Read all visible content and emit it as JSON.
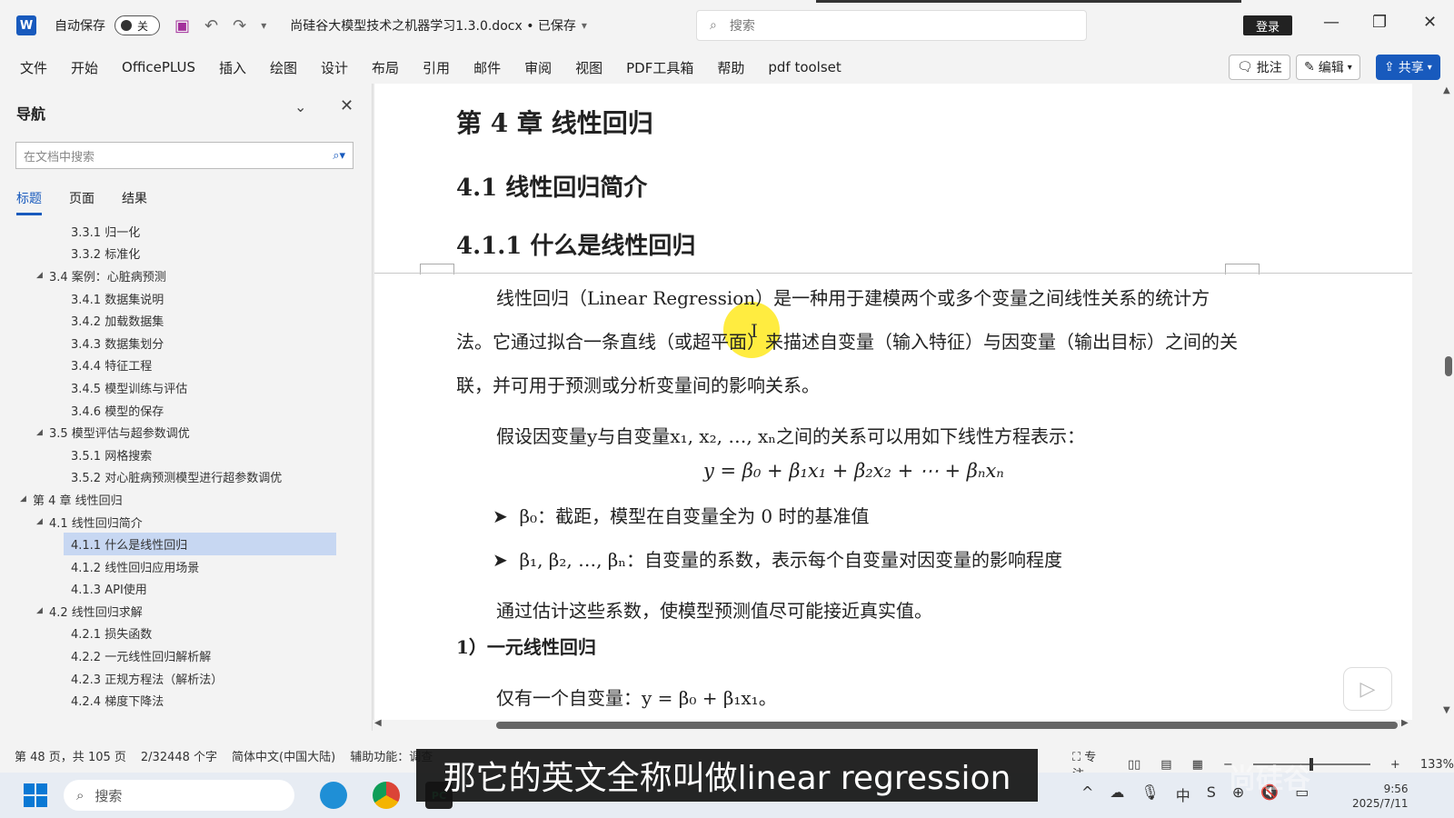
{
  "titlebar": {
    "app_icon": "W",
    "autosave_label": "自动保存",
    "autosave_state": "关",
    "document_title": "尚硅谷大模型技术之机器学习1.3.0.docx • 已保存",
    "search_placeholder": "搜索",
    "login_label": "登录"
  },
  "ribbon": {
    "tabs": [
      "文件",
      "开始",
      "OfficePLUS",
      "插入",
      "绘图",
      "设计",
      "布局",
      "引用",
      "邮件",
      "审阅",
      "视图",
      "PDF工具箱",
      "帮助",
      "pdf toolset"
    ],
    "comment_label": "批注",
    "edit_label": "编辑",
    "share_label": "共享"
  },
  "nav": {
    "title": "导航",
    "search_placeholder": "在文档中搜索",
    "tabs": [
      "标题",
      "页面",
      "结果"
    ],
    "items": [
      {
        "label": "3.3.1 归一化",
        "level": 3,
        "arrow": ""
      },
      {
        "label": "3.3.2 标准化",
        "level": 3,
        "arrow": ""
      },
      {
        "label": "3.4 案例：心脏病预测",
        "level": 2,
        "arrow": "◢"
      },
      {
        "label": "3.4.1 数据集说明",
        "level": 3,
        "arrow": ""
      },
      {
        "label": "3.4.2 加载数据集",
        "level": 3,
        "arrow": ""
      },
      {
        "label": "3.4.3 数据集划分",
        "level": 3,
        "arrow": ""
      },
      {
        "label": "3.4.4 特征工程",
        "level": 3,
        "arrow": ""
      },
      {
        "label": "3.4.5 模型训练与评估",
        "level": 3,
        "arrow": ""
      },
      {
        "label": "3.4.6 模型的保存",
        "level": 3,
        "arrow": ""
      },
      {
        "label": "3.5 模型评估与超参数调优",
        "level": 2,
        "arrow": "◢"
      },
      {
        "label": "3.5.1 网格搜索",
        "level": 3,
        "arrow": ""
      },
      {
        "label": "3.5.2 对心脏病预测模型进行超参数调优",
        "level": 3,
        "arrow": ""
      },
      {
        "label": "第 4 章 线性回归",
        "level": 1,
        "arrow": "◢"
      },
      {
        "label": "4.1 线性回归简介",
        "level": 2,
        "arrow": "◢"
      },
      {
        "label": "4.1.1 什么是线性回归",
        "level": 3,
        "arrow": "",
        "selected": true
      },
      {
        "label": "4.1.2 线性回归应用场景",
        "level": 3,
        "arrow": ""
      },
      {
        "label": "4.1.3 API使用",
        "level": 3,
        "arrow": ""
      },
      {
        "label": "4.2 线性回归求解",
        "level": 2,
        "arrow": "◢"
      },
      {
        "label": "4.2.1 损失函数",
        "level": 3,
        "arrow": ""
      },
      {
        "label": "4.2.2 一元线性回归解析解",
        "level": 3,
        "arrow": ""
      },
      {
        "label": "4.2.3 正规方程法（解析法）",
        "level": 3,
        "arrow": ""
      },
      {
        "label": "4.2.4 梯度下降法",
        "level": 3,
        "arrow": ""
      }
    ]
  },
  "document": {
    "chapter": "第 4 章 线性回归",
    "section": "4.1 线性回归简介",
    "subsection": "4.1.1 什么是线性回归",
    "para1": "线性回归（Linear Regression）是一种用于建模两个或多个变量之间线性关系的统计方法。它通过拟合一条直线（或超平面）来描述自变量（输入特征）与因变量（输出目标）之间的关联，并可用于预测或分析变量间的影响关系。",
    "para2": "假设因变量y与自变量x₁, x₂, …, xₙ之间的关系可以用如下线性方程表示：",
    "equation": "y = β₀ + β₁x₁ + β₂x₂ + ⋯ + βₙxₙ",
    "bullet1": "β₀：截距，模型在自变量全为 0 时的基准值",
    "bullet2": "β₁, β₂, …, βₙ：自变量的系数，表示每个自变量对因变量的影响程度",
    "para3": "通过估计这些系数，使模型预测值尽可能接近真实值。",
    "heading_onevar": "1）一元线性回归",
    "para4": "仅有一个自变量：y = β₀ + β₁x₁。"
  },
  "status": {
    "page": "第 48 页，共 105 页",
    "words": "2/32448 个字",
    "language": "简体中文(中国大陆)",
    "accessibility": "辅助功能：调查",
    "focus": "专注",
    "zoom": "133%"
  },
  "taskbar": {
    "search_placeholder": "搜索",
    "time": "9:56",
    "date": "2025/7/11"
  },
  "overlay": {
    "subtitle": "那它的英文全称叫做linear regression",
    "watermark": "尚硅谷"
  }
}
